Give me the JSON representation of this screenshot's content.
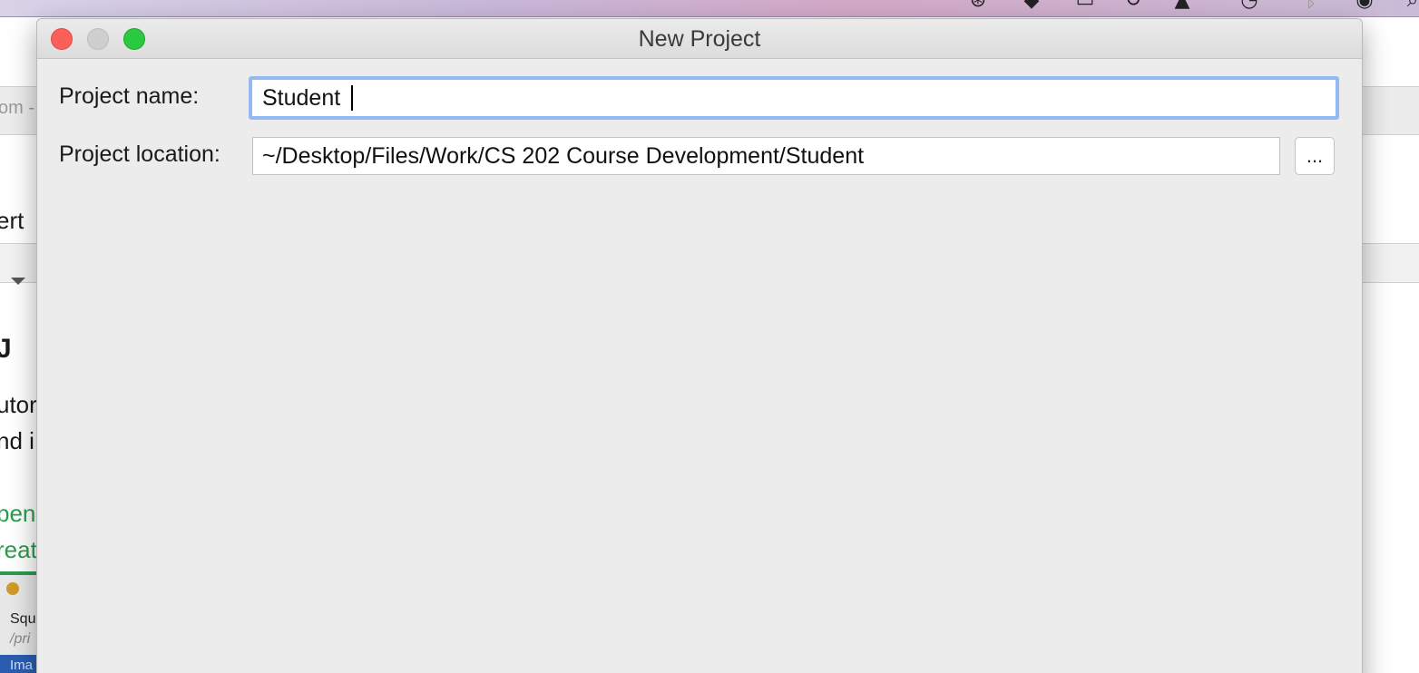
{
  "background_app": {
    "tab_crumb": "om -",
    "text_1": "ert",
    "heading_fragment": "J",
    "para_line_1": "utor",
    "para_line_2": "nd i",
    "link_1": "pen",
    "link_2": "reat",
    "mini_window": {
      "line_1": "Squ",
      "line_2": "/pri",
      "line_3": "Ima"
    }
  },
  "dialog": {
    "title": "New Project",
    "project_name": {
      "label": "Project name:",
      "value": "Student"
    },
    "project_location": {
      "label": "Project location:",
      "value": "~/Desktop/Files/Work/CS 202 Course Development/Student",
      "browse_label": "..."
    }
  },
  "colors": {
    "dialog_bg": "#ececec",
    "focus_ring": "#93b9ef",
    "close": "#fc5f57",
    "minimize_disabled": "#cfcfcf",
    "maximize": "#2ac93f",
    "link_green": "#2e9a4e"
  },
  "icons": [
    "close-icon",
    "minimize-icon",
    "maximize-icon",
    "chevron-down-icon"
  ]
}
